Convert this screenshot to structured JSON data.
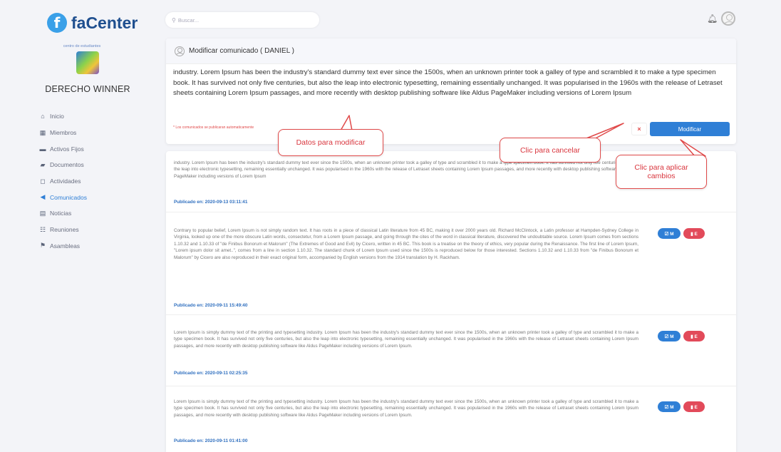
{
  "app": {
    "logo_letter": "f",
    "logo_text": "faCenter"
  },
  "sidebar": {
    "center_caption": "centro de estudiantes",
    "center_name": "DERECHO WINNER",
    "items": [
      {
        "icon": "home-icon",
        "glyph": "⌂",
        "label": "Inicio"
      },
      {
        "icon": "members-icon",
        "glyph": "▦",
        "label": "Miembros"
      },
      {
        "icon": "assets-icon",
        "glyph": "▬",
        "label": "Activos Fijos"
      },
      {
        "icon": "folder-icon",
        "glyph": "▰",
        "label": "Documentos"
      },
      {
        "icon": "activities-icon",
        "glyph": "◻",
        "label": "Actividades"
      },
      {
        "icon": "megaphone-icon",
        "glyph": "◀",
        "label": "Comunicados",
        "active": true
      },
      {
        "icon": "news-icon",
        "glyph": "▤",
        "label": "Noticias"
      },
      {
        "icon": "meetings-icon",
        "glyph": "☷",
        "label": "Reuniones"
      },
      {
        "icon": "assemblies-icon",
        "glyph": "⚑",
        "label": "Asambleas"
      }
    ]
  },
  "search": {
    "placeholder": "Buscar..."
  },
  "editor": {
    "title": "Modificar comunicado ( DANIEL )",
    "text": "industry. Lorem Ipsum has been the industry's standard dummy text ever since the 1500s, when an unknown printer took a galley of type and scrambled it to make a type specimen book. It has survived not only five centuries, but also the leap into electronic typesetting, remaining essentially unchanged. It was popularised in the 1960s with the release of Letraset sheets containing Lorem Ipsum passages, and more recently with desktop publishing software like Aldus PageMaker including versions of Lorem Ipsum",
    "note": "* Los comunicados se publicaran automaticamente",
    "cancel_label": "×",
    "modify_label": "Modificar"
  },
  "posts": [
    {
      "text": "industry. Lorem Ipsum has been the industry's standard dummy text ever since the 1500s, when an unknown printer took a galley of type and scrambled it to make a type specimen book. It has survived not only five centuries, but also the leap into electronic typesetting, remaining essentially unchanged. It was popularised in the 1960s with the release of Letraset sheets containing Lorem Ipsum passages, and more recently with desktop publishing software like Aldus PageMaker including versions of Lorem Ipsum",
      "date": "Publicado en: 2020-09-13 03:11:41"
    },
    {
      "text": "Contrary to popular belief, Lorem Ipsum is not simply random text. It has roots in a piece of classical Latin literature from 45 BC, making it over 2000 years old. Richard McClintock, a Latin professor at Hampden-Sydney College in Virginia, looked up one of the more obscure Latin words, consectetur, from a Lorem Ipsum passage, and going through the cites of the word in classical literature, discovered the undoubtable source. Lorem Ipsum comes from sections 1.10.32 and 1.10.33 of \"de Finibus Bonorum et Malorum\" (The Extremes of Good and Evil) by Cicero, written in 45 BC. This book is a treatise on the theory of ethics, very popular during the Renaissance. The first line of Lorem Ipsum, \"Lorem ipsum dolor sit amet..\", comes from a line in section 1.10.32. The standard chunk of Lorem Ipsum used since the 1500s is reproduced below for those interested. Sections 1.10.32 and 1.10.33 from \"de Finibus Bonorum et Malorum\" by Cicero are also reproduced in their exact original form, accompanied by English versions from the 1914 translation by H. Rackham.",
      "date": "Publicado en: 2020-09-11 15:49:40",
      "edit_label": "☑ M",
      "delete_label": "▮ E"
    },
    {
      "text": "Lorem Ipsum is simply dummy text of the printing and typesetting industry. Lorem Ipsum has been the industry's standard dummy text ever since the 1500s, when an unknown printer took a galley of type and scrambled it to make a type specimen book. It has survived not only five centuries, but also the leap into electronic typesetting, remaining essentially unchanged. It was popularised in the 1960s with the release of Letraset sheets containing Lorem Ipsum passages, and more recently with desktop publishing software like Aldus PageMaker including versions of Lorem Ipsum.",
      "date": "Publicado en: 2020-09-11 02:25:35",
      "edit_label": "☑ M",
      "delete_label": "▮ E"
    },
    {
      "text": "Lorem Ipsum is simply dummy text of the printing and typesetting industry. Lorem Ipsum has been the industry's standard dummy text ever since the 1500s, when an unknown printer took a galley of type and scrambled it to make a type specimen book. It has survived not only five centuries, but also the leap into electronic typesetting, remaining essentially unchanged. It was popularised in the 1960s with the release of Letraset sheets containing Lorem Ipsum passages, and more recently with desktop publishing software like Aldus PageMaker including versions of Lorem Ipsum.",
      "date": "Publicado en: 2020-09-11 01:41:00",
      "edit_label": "☑ M",
      "delete_label": "▮ E"
    }
  ],
  "callouts": {
    "data": "Datos para modificar",
    "cancel": "Clic para cancelar",
    "apply_line1": "Clic para aplicar",
    "apply_line2": "cambios"
  },
  "colors": {
    "accent": "#2f7fd6",
    "danger": "#e24a5a",
    "callout_red": "#e04a4a",
    "logo_dark": "#1f4f8f"
  }
}
